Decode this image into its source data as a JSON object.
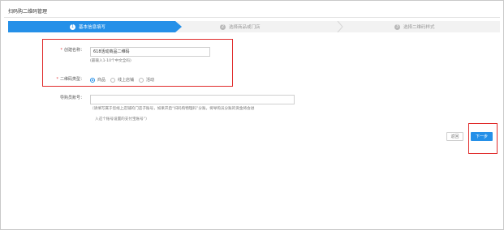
{
  "page": {
    "title": "扫码购二维码管理"
  },
  "steps": [
    {
      "num": "1",
      "label": "基本信息填写",
      "active": true
    },
    {
      "num": "2",
      "label": "选择商品或门店",
      "active": false
    },
    {
      "num": "3",
      "label": "选择二维码样式",
      "active": false
    }
  ],
  "form": {
    "name": {
      "required_mark": "*",
      "label": "创建名称：",
      "value": "618活动商品二维码",
      "hint": "(最输入1-10个中文全码)"
    },
    "type": {
      "required_mark": "*",
      "label": "二维码类型：",
      "options": [
        {
          "label": "商品",
          "checked": true
        },
        {
          "label": "线上店铺",
          "checked": false
        },
        {
          "label": "活动",
          "checked": false
        }
      ]
    },
    "guide": {
      "label": "导购员账号：",
      "value": "",
      "hint_line1": "（请填写属于您线上店铺的门店子账号，如果开启“扫码购物理码”分账，将导购员分账的资金将会进",
      "hint_line2": "入这个账号设置的支付宝账号”）"
    }
  },
  "buttons": {
    "back": "返回",
    "next": "下一步"
  },
  "colors": {
    "accent": "#2590e8",
    "highlight": "#e02a2a"
  }
}
